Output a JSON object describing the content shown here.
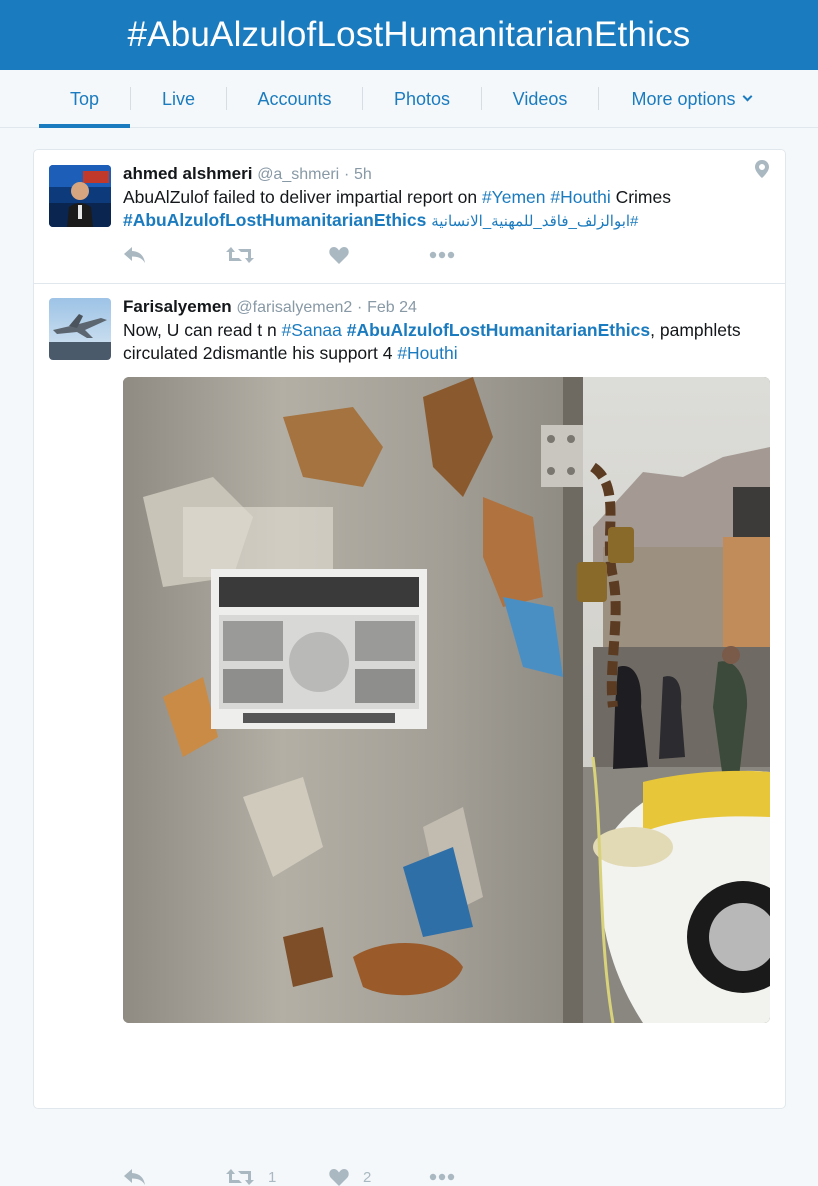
{
  "header": {
    "title": "#AbuAlzulofLostHumanitarianEthics"
  },
  "tabs": [
    {
      "label": "Top",
      "active": true
    },
    {
      "label": "Live"
    },
    {
      "label": "Accounts"
    },
    {
      "label": "Photos"
    },
    {
      "label": "Videos"
    },
    {
      "label": "More options"
    }
  ],
  "tweets": [
    {
      "name": "ahmed alshmeri",
      "handle": "@a_shmeri",
      "sep": "·",
      "time": "5h",
      "text": {
        "p1": "AbuAlZulof failed to deliver impartial report on ",
        "tag1": "#Yemen",
        "tag2": "#Houthi",
        "p2": " Crimes",
        "tag3": "#AbuAlzulofLostHumanitarianEthics",
        "arabic": "#ابوالزلف_فاقد_للمهنية_الانسانية"
      },
      "retweets": "",
      "likes": ""
    },
    {
      "name": "Farisalyemen",
      "handle": "@farisalyemen2",
      "sep": "·",
      "time": "Feb 24",
      "text": {
        "p1": "Now, U can read t n ",
        "tag1": "#Sanaa",
        "tag2": "#AbuAlzulofLostHumanitarianEthics",
        "p2": ",  pamphlets circulated 2dismantle his support 4 ",
        "tag3": "#Houthi"
      },
      "retweets": "1",
      "likes": "2"
    }
  ],
  "icons": {
    "reply": "reply-icon",
    "retweet": "retweet-icon",
    "like": "heart-icon",
    "more": "more-dots-icon",
    "location": "location-pin-icon"
  },
  "colors": {
    "brand": "#1b7bbf",
    "muted": "#aab8c2"
  }
}
